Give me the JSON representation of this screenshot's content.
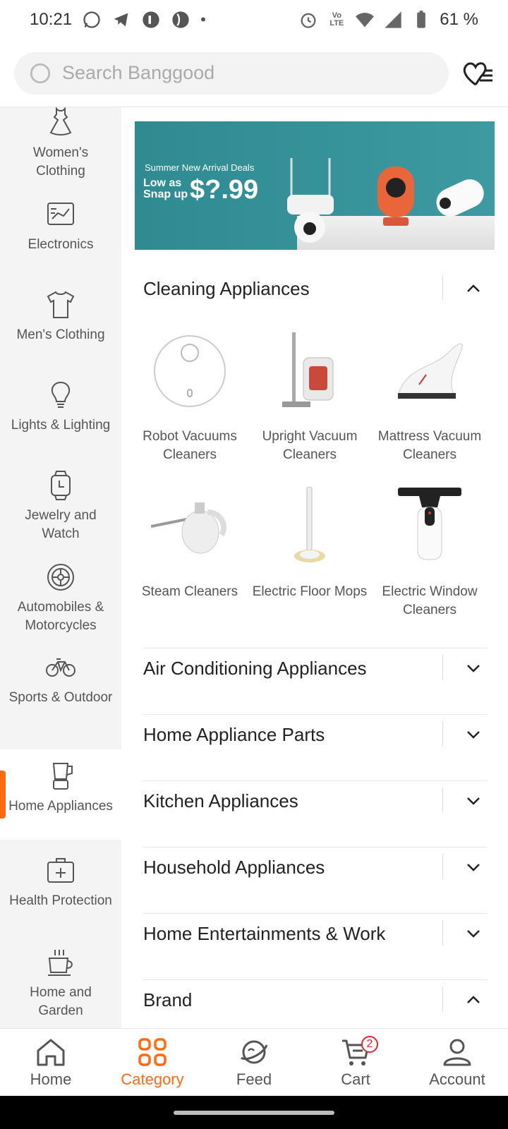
{
  "status": {
    "time": "10:21",
    "battery": "61 %"
  },
  "search": {
    "placeholder": "Search Banggood"
  },
  "sidebar": {
    "items": [
      {
        "label": "Women's Clothing",
        "icon": "dress-icon"
      },
      {
        "label": "Electronics",
        "icon": "circuit-board-icon"
      },
      {
        "label": "Men's Clothing",
        "icon": "tshirt-icon"
      },
      {
        "label": "Lights & Lighting",
        "icon": "lightbulb-icon"
      },
      {
        "label": "Jewelry and Watch",
        "icon": "watch-icon"
      },
      {
        "label": "Automobiles & Motorcycles",
        "icon": "steering-wheel-icon"
      },
      {
        "label": "Sports & Outdoor",
        "icon": "bicycle-icon"
      },
      {
        "label": "Home Appliances",
        "icon": "blender-icon",
        "active": true
      },
      {
        "label": "Health Protection",
        "icon": "first-aid-kit-icon"
      },
      {
        "label": "Home and Garden",
        "icon": "coffee-cup-icon"
      }
    ]
  },
  "banner": {
    "line1": "Summer New Arrival Deals",
    "low_as": "Low as Snap up",
    "price": "$?.99"
  },
  "sections": [
    {
      "label": "Cleaning Appliances",
      "expanded": true
    },
    {
      "label": "Air Conditioning Appliances",
      "expanded": false
    },
    {
      "label": "Home Appliance Parts",
      "expanded": false
    },
    {
      "label": "Kitchen Appliances",
      "expanded": false
    },
    {
      "label": "Household Appliances",
      "expanded": false
    },
    {
      "label": "Home Entertainments & Work",
      "expanded": false
    },
    {
      "label": "Brand",
      "expanded": true
    }
  ],
  "products": [
    {
      "label": "Robot Vacuums Cleaners"
    },
    {
      "label": "Upright Vacuum Cleaners"
    },
    {
      "label": "Mattress Vacuum Cleaners"
    },
    {
      "label": "Steam Cleaners"
    },
    {
      "label": "Electric Floor Mops"
    },
    {
      "label": "Electric Window Cleaners"
    }
  ],
  "tabs": [
    {
      "label": "Home",
      "icon": "home-icon"
    },
    {
      "label": "Category",
      "icon": "grid-icon",
      "active": true
    },
    {
      "label": "Feed",
      "icon": "planet-icon"
    },
    {
      "label": "Cart",
      "icon": "cart-icon",
      "badge": "2"
    },
    {
      "label": "Account",
      "icon": "person-icon"
    }
  ],
  "colors": {
    "accent": "#ff6a13",
    "badge": "#e4242b",
    "sidebar_bg": "#f4f4f4"
  }
}
